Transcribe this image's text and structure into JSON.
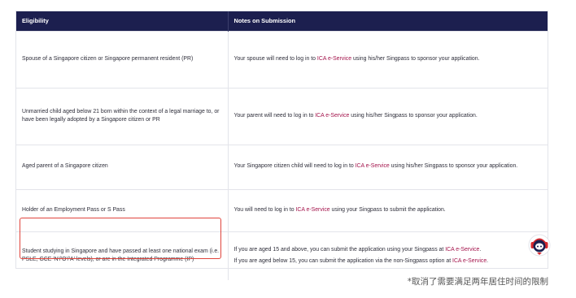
{
  "table": {
    "headers": [
      "Eligibility",
      "Notes on Submission"
    ],
    "rows": [
      {
        "eligibility": "Spouse of a Singapore citizen or Singapore permanent resident (PR)",
        "note_before": "Your spouse will need to log in to ",
        "note_link": "ICA e-Service",
        "note_after": " using his/her Singpass to sponsor your application."
      },
      {
        "eligibility": "Unmarried child aged below 21 born within the context of a legal marriage to, or have been legally adopted by a Singapore citizen or PR",
        "note_before": "Your parent will need to log in to ",
        "note_link": "ICA e-Service",
        "note_after": " using his/her Singpass to sponsor your application."
      },
      {
        "eligibility": "Aged parent of a Singapore citizen",
        "note_before": "Your Singapore citizen child will need to log in to ",
        "note_link": "ICA e-Service",
        "note_after": " using his/her Singpass to sponsor your application."
      },
      {
        "eligibility": "Holder of an Employment Pass or S Pass",
        "note_before": "You will need to log in to ",
        "note_link": "ICA e-Service",
        "note_after": " using your Singpass to submit the application."
      },
      {
        "eligibility": "Student studying in Singapore and have passed at least one national exam (i.e. PSLE, GCE 'N'/'O'/'A' levels), or are in the Integrated Programme (IP)",
        "note1_before": "If you are aged 15 and above, you can submit the application using your Singpass at ",
        "note1_link": "ICA e-Service",
        "note1_after": ".",
        "note2_before": "If you are aged below 15, you can submit the application via the non-Singpass option at ",
        "note2_link": "ICA e-Service",
        "note2_after": "."
      }
    ]
  },
  "footnote": "*取消了需要满足两年居住时间的限制",
  "colors": {
    "header_bg": "#1c1f4f",
    "link": "#a3124a",
    "highlight": "#e0443c"
  },
  "icons": {
    "assistant": "chat-assistant-avatar-icon"
  }
}
